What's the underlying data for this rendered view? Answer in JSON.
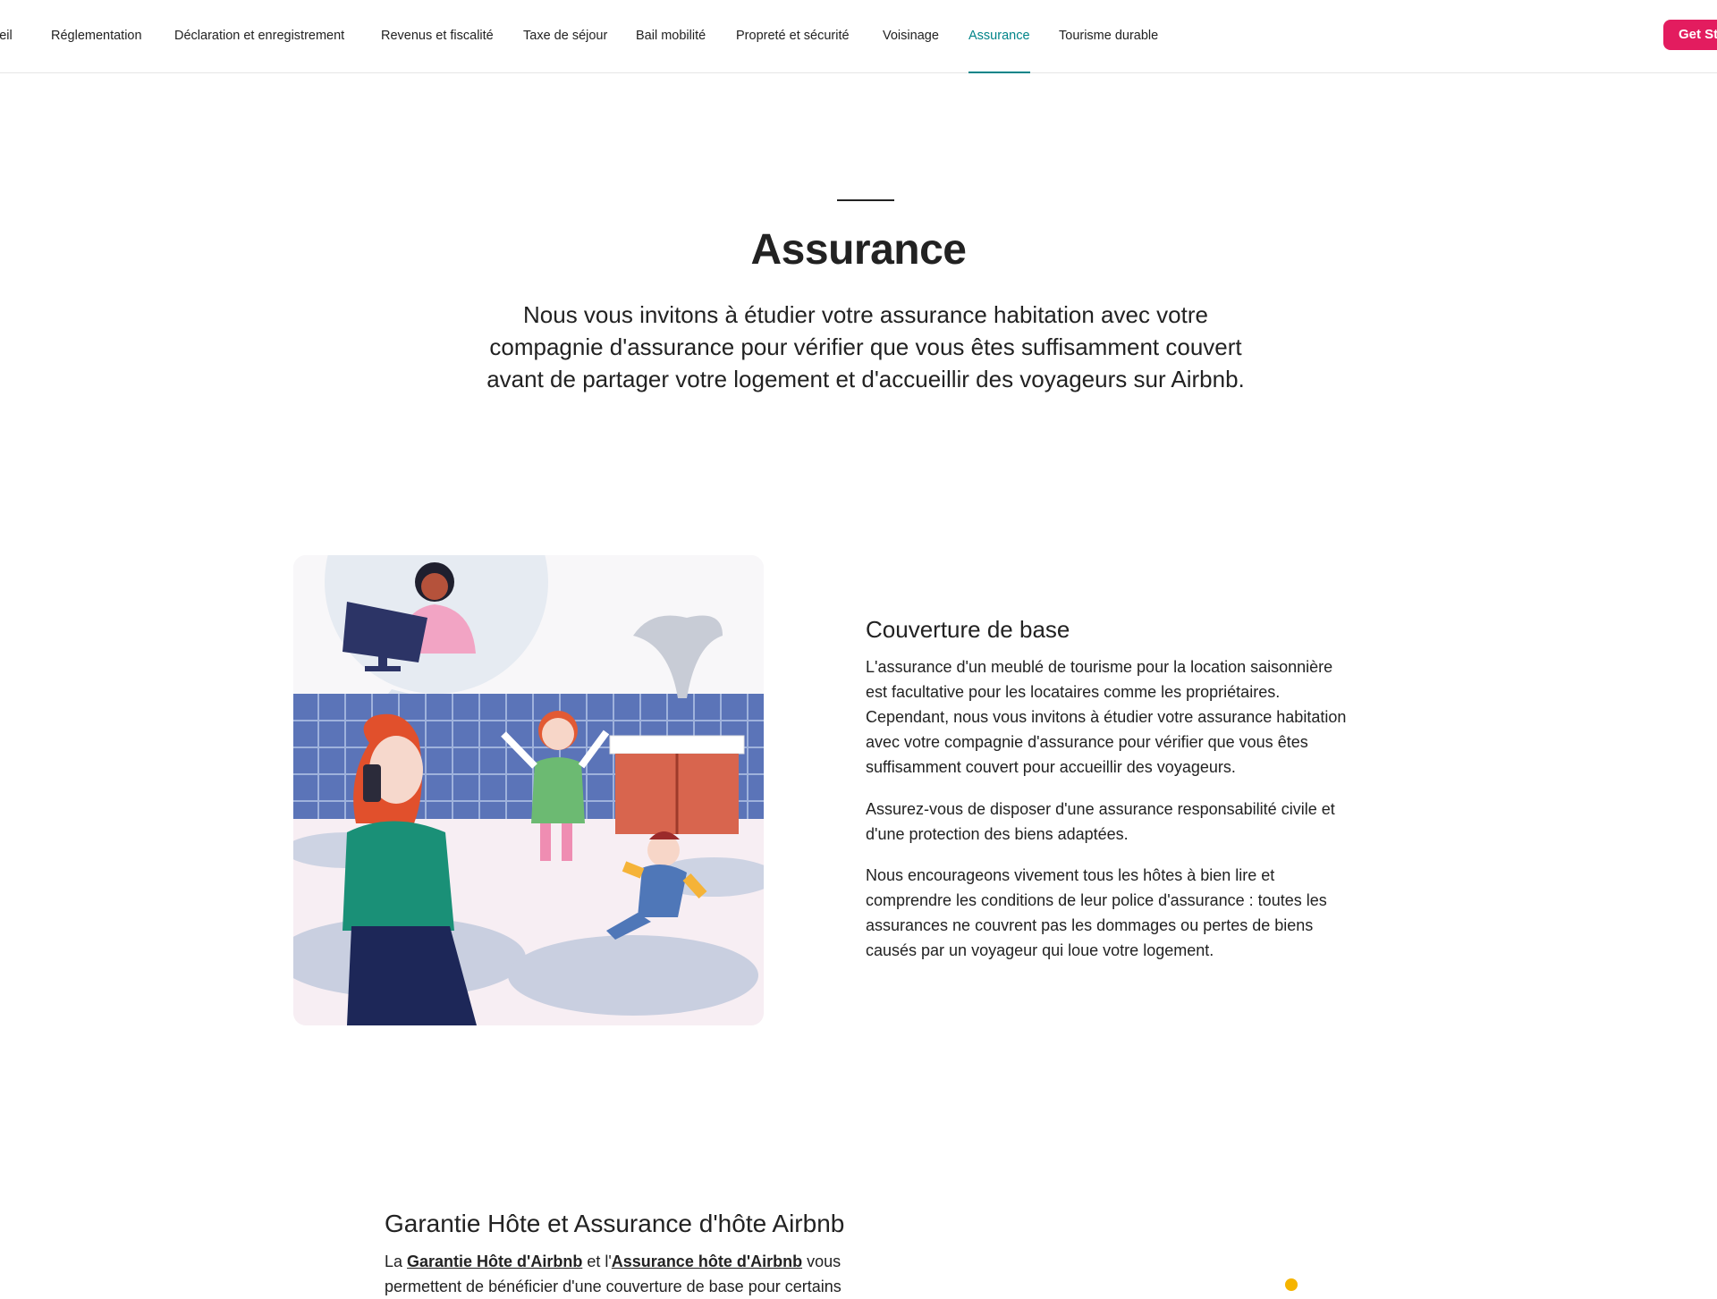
{
  "nav": {
    "items": [
      {
        "label": "Accueil"
      },
      {
        "label": "Réglementation"
      },
      {
        "label": "Déclaration et enregistrement"
      },
      {
        "label": "Revenus et fiscalité"
      },
      {
        "label": "Taxe de séjour"
      },
      {
        "label": "Bail mobilité"
      },
      {
        "label": "Propreté et sécurité"
      },
      {
        "label": "Voisinage"
      },
      {
        "label": "Assurance"
      },
      {
        "label": "Tourisme durable"
      }
    ],
    "active": "Assurance",
    "cta_label": "Get Started"
  },
  "hero": {
    "title": "Assurance",
    "intro": "Nous vous invitons à étudier votre assurance habitation avec votre compagnie d'assurance pour vérifier que vous êtes suffisamment couvert avant de partager votre logement et d'accueillir des voyageurs sur Airbnb."
  },
  "coverage": {
    "heading": "Couverture de base",
    "paragraphs": [
      "L'assurance d'un meublé de tourisme pour la location saisonnière est facultative pour les locataires comme les propriétaires. Cependant, nous vous invitons à étudier votre assurance habitation avec votre compagnie d'assurance pour vérifier que vous êtes suffisamment couvert pour accueillir des voyageurs.",
      "Assurez-vous de disposer d'une assurance responsabilité civile et d'une protection des biens adaptées.",
      "Nous encourageons vivement tous les hôtes à bien lire et comprendre les conditions de leur police d'assurance : toutes les assurances ne couvrent pas les dommages ou pertes de biens causés par un voyageur qui loue votre logement."
    ]
  },
  "garantie": {
    "heading": "Garantie Hôte et Assurance d'hôte Airbnb",
    "text_prefix": "La ",
    "link1": "Garantie Hôte d'Airbnb",
    "text_middle": " et l'",
    "link2": "Assurance hôte d'Airbnb",
    "text_suffix": " vous permettent de bénéficier d'une couverture de base pour certains"
  },
  "colors": {
    "accent": "#008489",
    "cta": "#e31c5f",
    "text": "#222222"
  }
}
